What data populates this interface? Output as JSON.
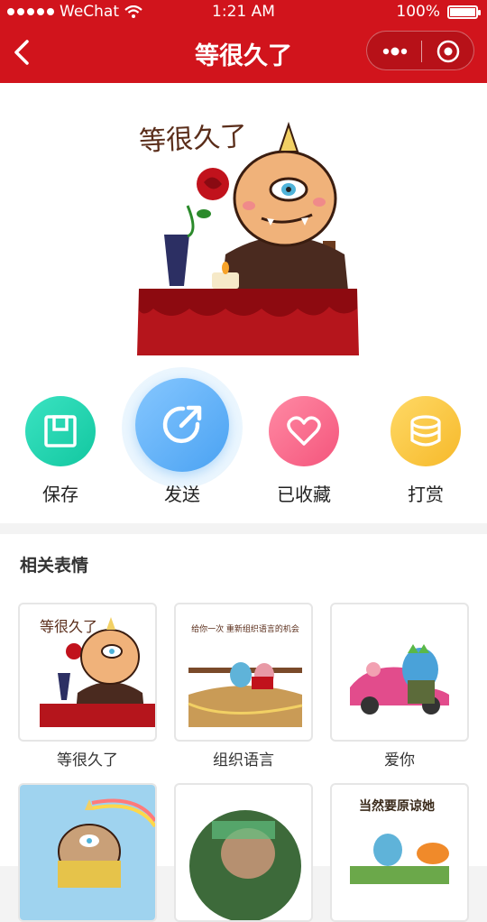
{
  "status_bar": {
    "carrier": "WeChat",
    "time": "1:21 AM",
    "battery": "100%"
  },
  "nav": {
    "title": "等很久了"
  },
  "sticker": {
    "caption": "等很久了"
  },
  "actions": [
    {
      "label": "保存",
      "icon": "save-icon",
      "color": "#1fd6b0"
    },
    {
      "label": "发送",
      "icon": "share-icon",
      "color": "#5db1f6"
    },
    {
      "label": "已收藏",
      "icon": "heart-icon",
      "color": "#f7698a"
    },
    {
      "label": "打赏",
      "icon": "coins-icon",
      "color": "#f8c642"
    }
  ],
  "related": {
    "title": "相关表情",
    "items": [
      {
        "label": "等很久了",
        "caption": "等很久了"
      },
      {
        "label": "组织语言",
        "caption": "给你一次 重新组织语言的机会"
      },
      {
        "label": "爱你",
        "caption": ""
      },
      {
        "label": "",
        "caption": ""
      },
      {
        "label": "",
        "caption": ""
      },
      {
        "label": "",
        "caption": "当然要原谅她"
      }
    ]
  }
}
